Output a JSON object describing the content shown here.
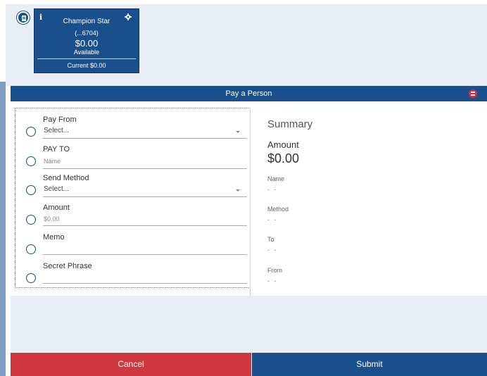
{
  "colors": {
    "primary": "#1b4f8c",
    "danger": "#d0363e",
    "background": "#e9eef5"
  },
  "card": {
    "info_icon": "i",
    "name": "Champion Star",
    "account_mask": "(...6704)",
    "balance": "$0.00",
    "available_label": "Available",
    "current": "Current $0.00"
  },
  "title_bar": {
    "title": "Pay a Person",
    "print_icon": "print-icon"
  },
  "form": {
    "fields": [
      {
        "label": "Pay From",
        "value": "Select...",
        "type": "select"
      },
      {
        "label": "PAY TO",
        "value": "Name",
        "type": "text-placeholder"
      },
      {
        "label": "Send Method",
        "value": "Select...",
        "type": "select"
      },
      {
        "label": "Amount",
        "value": "$0.00",
        "type": "text-placeholder"
      },
      {
        "label": "Memo",
        "value": "",
        "type": "text"
      },
      {
        "label": "Secret Phrase",
        "value": "",
        "type": "text"
      }
    ]
  },
  "summary": {
    "title": "Summary",
    "amount_label": "Amount",
    "amount_value": "$0.00",
    "items": [
      {
        "label": "Name",
        "value": "- -"
      },
      {
        "label": "Method",
        "value": "- -"
      },
      {
        "label": "To",
        "value": "- -"
      },
      {
        "label": "From",
        "value": "- -"
      }
    ]
  },
  "actions": {
    "cancel_label": "Cancel",
    "submit_label": "Submit"
  }
}
